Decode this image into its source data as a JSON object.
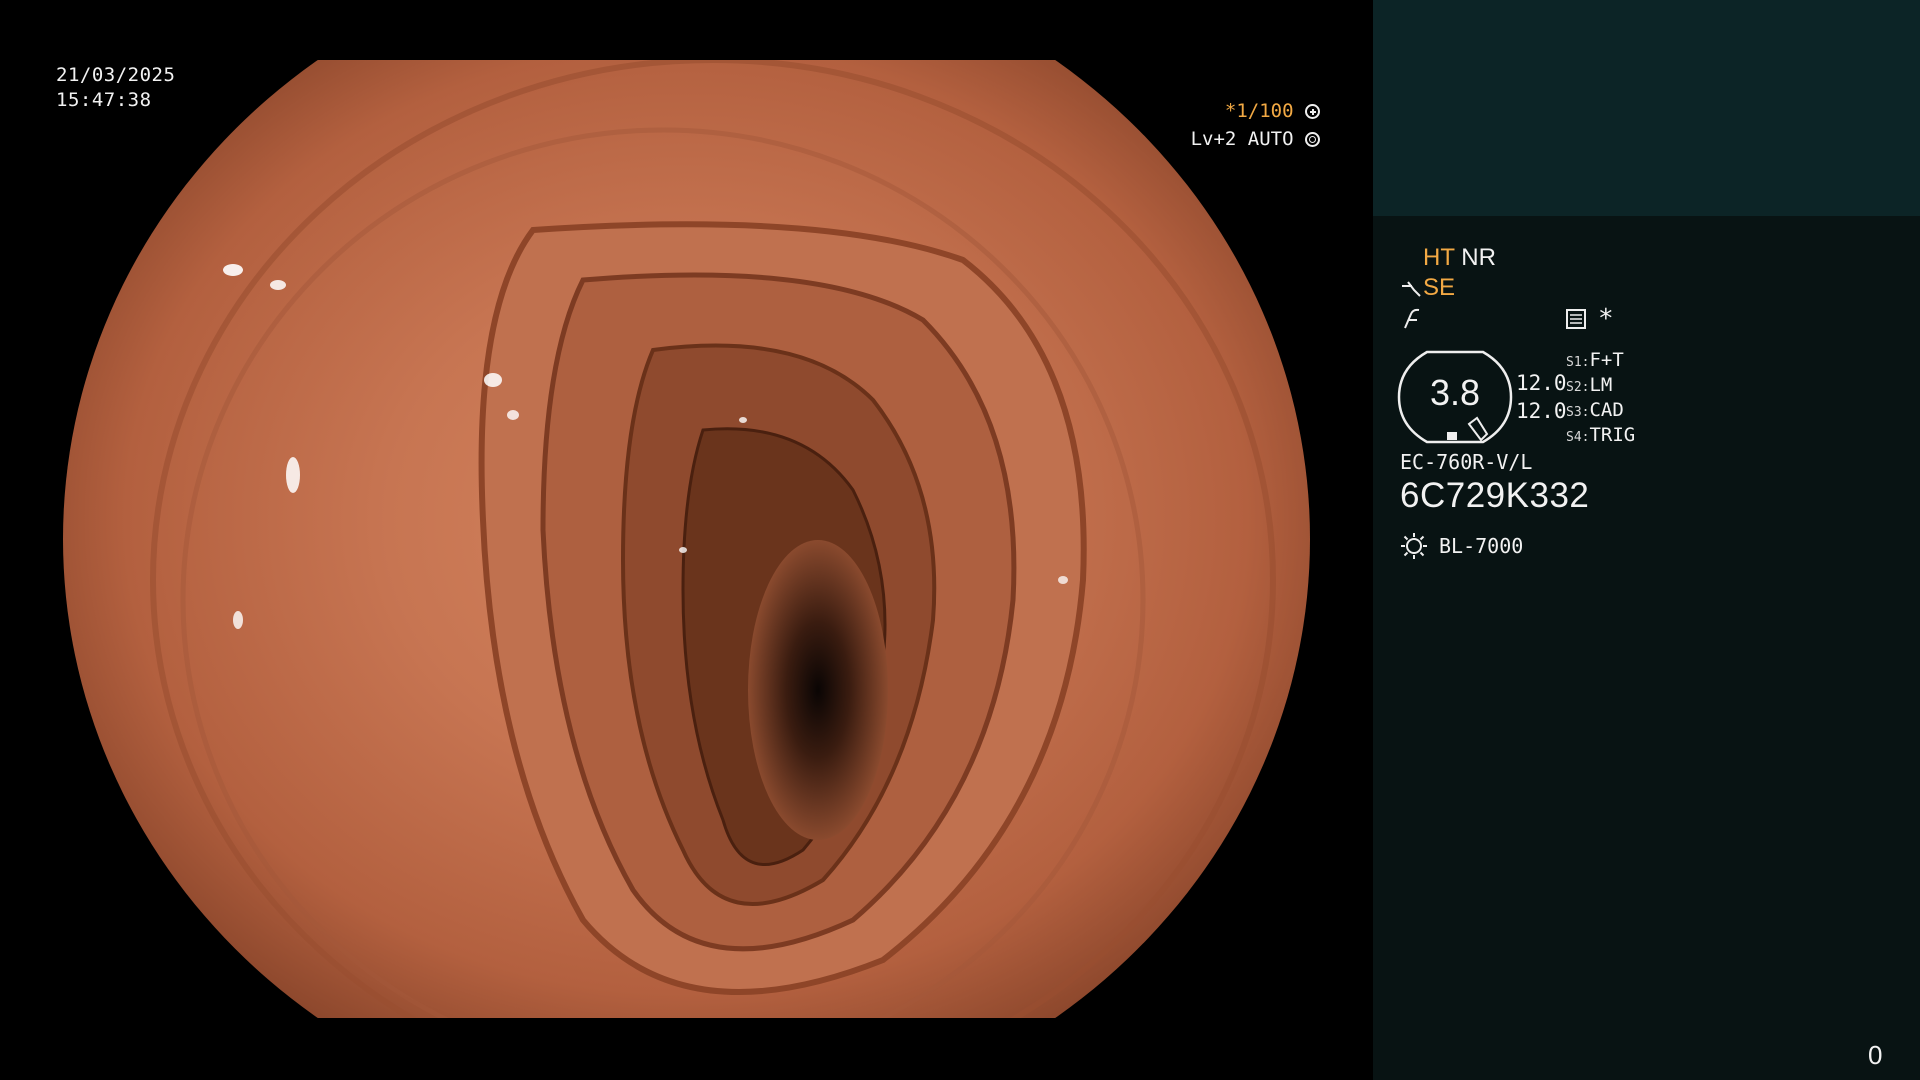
{
  "overlay": {
    "date": "21/03/2025",
    "time": "15:47:38",
    "shutter": "*1/100",
    "shutter_icon": "aperture-icon",
    "level": "Lv+2 AUTO",
    "level_icon": "iris-icon"
  },
  "panel": {
    "mode_ht": "HT",
    "mode_nr": "NR",
    "mode_se": "SE",
    "zoom_value": "3.8",
    "val_top": "12.0",
    "val_bottom": "12.0",
    "switches": [
      {
        "key": "S1:",
        "value": "F+T"
      },
      {
        "key": "S2:",
        "value": "LM"
      },
      {
        "key": "S3:",
        "value": "CAD"
      },
      {
        "key": "S4:",
        "value": "TRIG"
      }
    ],
    "scope_model": "EC-760R-V/L",
    "scope_serial": "6C729K332",
    "light_source": "BL-7000",
    "asterisk": "*",
    "counter": "0"
  },
  "colors": {
    "highlight": "#f2a944",
    "panel_bg": "#081313",
    "panel_top_bg": "#0c2426"
  }
}
